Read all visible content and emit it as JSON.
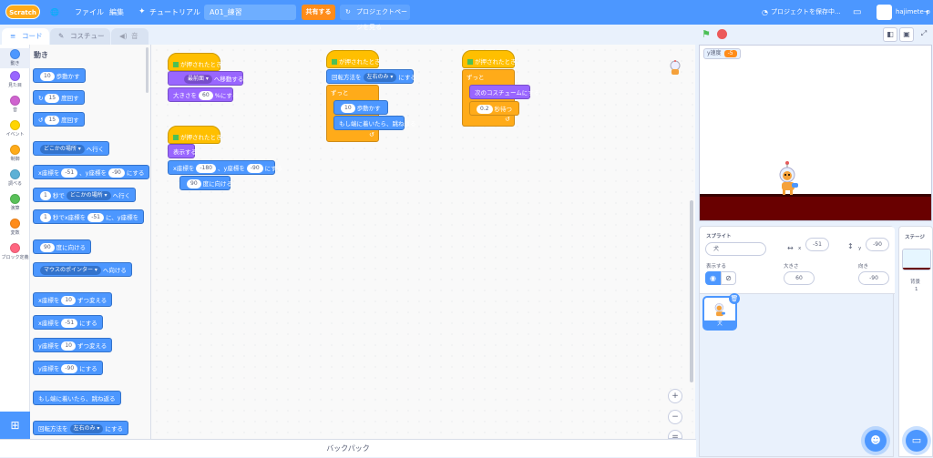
{
  "menu": {
    "logo": "Scratch",
    "globe": "🌐",
    "file": "ファイル",
    "edit": "編集",
    "tutorial": "チュートリアル",
    "title": "A01_練習",
    "share": "共有する",
    "project_page": "プロジェクトページを見る",
    "saving": "プロジェクトを保存中...",
    "user": "hajimete-p"
  },
  "tabs": {
    "code": "コード",
    "costume": "コスチューム",
    "sound": "音"
  },
  "categories": [
    {
      "label": "動き",
      "color": "#4c97ff"
    },
    {
      "label": "見た目",
      "color": "#9966ff"
    },
    {
      "label": "音",
      "color": "#cf63cf"
    },
    {
      "label": "イベント",
      "color": "#ffd500"
    },
    {
      "label": "制御",
      "color": "#ffab19"
    },
    {
      "label": "調べる",
      "color": "#5cb1d6"
    },
    {
      "label": "演算",
      "color": "#59c059"
    },
    {
      "label": "変数",
      "color": "#ff8c1a"
    },
    {
      "label": "ブロック定義",
      "color": "#ff6680"
    }
  ],
  "palette": {
    "title": "動き",
    "blocks": [
      {
        "pre": "",
        "v1": "10",
        "post": "歩動かす"
      },
      {
        "pre": "↻",
        "v1": "15",
        "post": "度回す"
      },
      {
        "pre": "↺",
        "v1": "15",
        "post": "度回す"
      },
      {
        "pre": "",
        "v1": "どこかの場所 ▾",
        "post": "へ行く"
      },
      {
        "pre": "x座標を",
        "v1": "-51",
        "mid": "、y座標を",
        "v2": "-90",
        "post": "にする"
      },
      {
        "pre": "",
        "v1": "1",
        "mid": "秒で",
        "v2": "どこかの場所 ▾",
        "post": "へ行く"
      },
      {
        "pre": "",
        "v1": "1",
        "mid": "秒でx座標を",
        "v2": "-51",
        "post": "に、y座標を"
      },
      {
        "pre": "",
        "v1": "90",
        "post": "度に向ける"
      },
      {
        "pre": "",
        "v1": "マウスのポインター ▾",
        "post": "へ向ける"
      },
      {
        "pre": "x座標を",
        "v1": "10",
        "post": "ずつ変える"
      },
      {
        "pre": "x座標を",
        "v1": "-51",
        "post": "にする"
      },
      {
        "pre": "y座標を",
        "v1": "10",
        "post": "ずつ変える"
      },
      {
        "pre": "y座標を",
        "v1": "-90",
        "post": "にする"
      },
      {
        "pre": "もし端に着いたら、跳ね返る",
        "v1": "",
        "post": ""
      },
      {
        "pre": "回転方法を",
        "v1": "左右のみ ▾",
        "post": "にする"
      }
    ]
  },
  "scripts": {
    "hat": "が押されたとき",
    "s1": {
      "b1_v": "最前面 ▾",
      "b1_t": "へ移動する",
      "b2_pre": "大きさを",
      "b2_v": "60",
      "b2_post": "%にする"
    },
    "s2": {
      "b1": "表示する",
      "b2_pre": "x座標を",
      "b2_v1": "-180",
      "b2_mid": "、y座標を",
      "b2_v2": "-90",
      "b2_post": "にする",
      "b3_v": "90",
      "b3_post": "度に向ける"
    },
    "s3": {
      "b1_pre": "回転方法を",
      "b1_v": "左右のみ ▾",
      "b1_post": "にする",
      "loop": "ずっと",
      "b2_v": "10",
      "b2_post": "歩動かす",
      "b3": "もし端に着いたら、跳ね返る",
      "arrow": "↺"
    },
    "s4": {
      "loop": "ずっと",
      "b1": "次のコスチュームにする",
      "b2_v": "0.2",
      "b2_post": "秒待つ",
      "arrow": "↺"
    }
  },
  "stage": {
    "monitor_label": "y速度",
    "monitor_value": "-5"
  },
  "sprite": {
    "header": "スプライト",
    "name": "犬",
    "x_label": "x",
    "x": "-51",
    "y_label": "y",
    "y": "-90",
    "show_label": "表示する",
    "size_label": "大きさ",
    "size": "60",
    "dir_label": "向き",
    "dir": "-90",
    "thumb_name": "犬"
  },
  "stagepanel": {
    "header": "ステージ",
    "backdrops_label": "背景",
    "backdrops_count": "1"
  },
  "backpack": "バックパック"
}
